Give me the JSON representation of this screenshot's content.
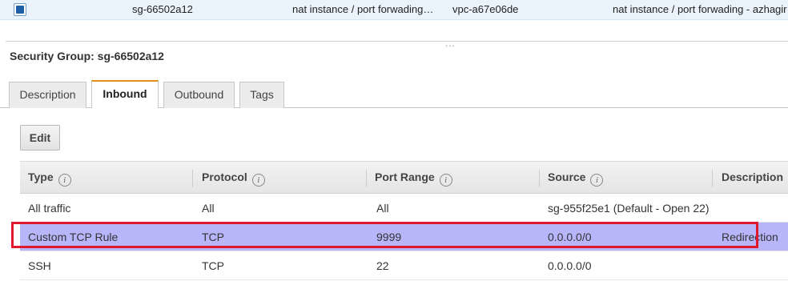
{
  "instance_row": {
    "group_id": "sg-66502a12",
    "group_name": "nat instance / port forwading…",
    "vpc_id": "vpc-a67e06de",
    "description": "nat instance / port forwading - azhagir"
  },
  "splitter_grip": "◦◦◦",
  "detail_title": "Security Group: sg-66502a12",
  "tabs": {
    "description": "Description",
    "inbound": "Inbound",
    "outbound": "Outbound",
    "tags": "Tags",
    "active": "Inbound"
  },
  "edit_label": "Edit",
  "info_glyph": "i",
  "columns": {
    "type": "Type",
    "protocol": "Protocol",
    "port_range": "Port Range",
    "source": "Source",
    "description": "Description"
  },
  "rules": [
    {
      "type": "All traffic",
      "protocol": "All",
      "port_range": "All",
      "source": "sg-955f25e1 (Default - Open 22)",
      "description": ""
    },
    {
      "type": "Custom TCP Rule",
      "protocol": "TCP",
      "port_range": "9999",
      "source": "0.0.0.0/0",
      "description": "Redirection"
    },
    {
      "type": "SSH",
      "protocol": "TCP",
      "port_range": "22",
      "source": "0.0.0.0/0",
      "description": ""
    }
  ],
  "highlight_color": "#e0192f",
  "selected_row_color": "#b7b6fa",
  "active_tab_accent": "#e38f1c"
}
